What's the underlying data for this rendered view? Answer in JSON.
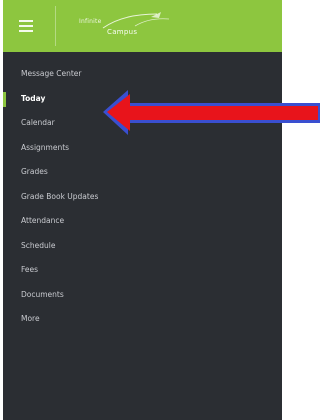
{
  "header": {
    "menu_icon": "hamburger-menu-icon",
    "logo": {
      "line1": "Infinite",
      "line2": "Campus"
    }
  },
  "nav": {
    "items": [
      {
        "label": "Message Center"
      },
      {
        "label": "Today"
      },
      {
        "label": "Calendar"
      },
      {
        "label": "Assignments"
      },
      {
        "label": "Grades"
      },
      {
        "label": "Grade Book Updates"
      },
      {
        "label": "Attendance"
      },
      {
        "label": "Schedule"
      },
      {
        "label": "Fees"
      },
      {
        "label": "Documents"
      },
      {
        "label": "More"
      }
    ],
    "active_index": 1
  },
  "annotation": {
    "arrow_color": "#e8141b",
    "arrow_outline": "#3a4fd0",
    "icon": "red-arrow-pointer-icon"
  },
  "colors": {
    "topbar": "#8dc63f",
    "sidebar": "#2b2e33",
    "accent": "#8dc63f"
  }
}
